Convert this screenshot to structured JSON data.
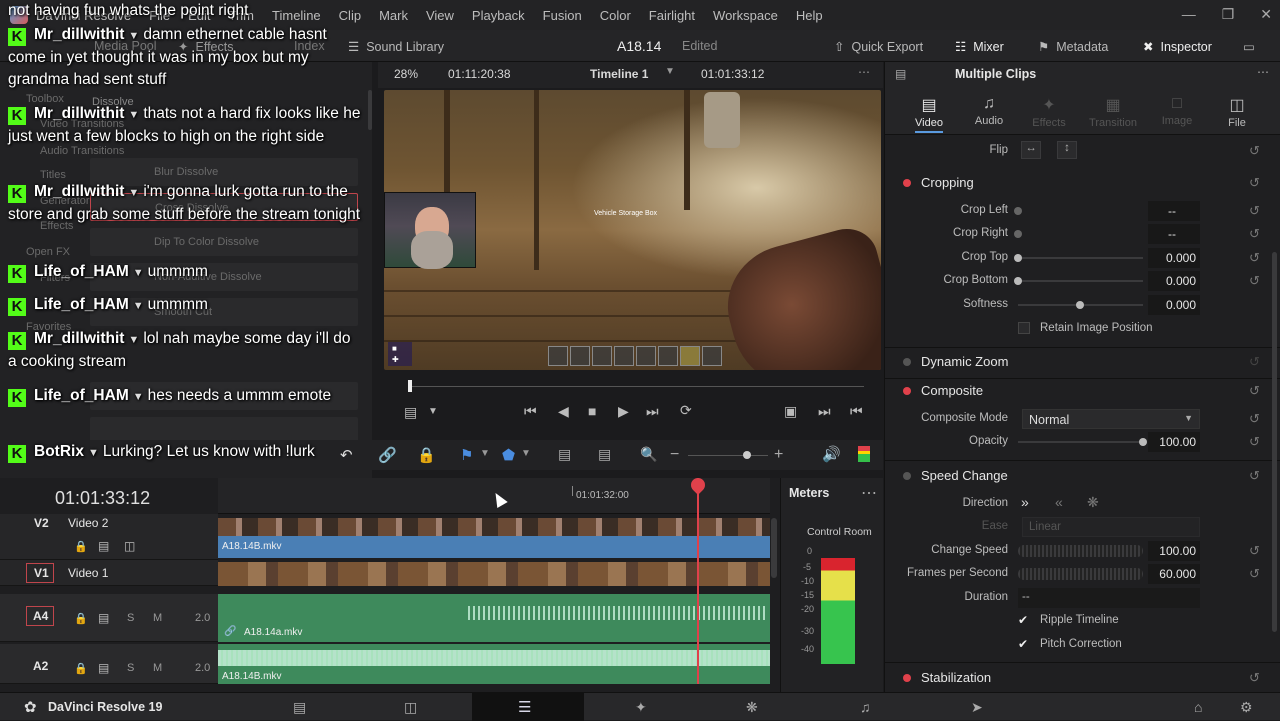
{
  "menubar": {
    "items": [
      "DaVinci Resolve",
      "File",
      "Edit",
      "Trim",
      "Timeline",
      "Clip",
      "Mark",
      "View",
      "Playback",
      "Fusion",
      "Color",
      "Fairlight",
      "Workspace",
      "Help"
    ]
  },
  "toolbar": {
    "media_pool": "Media Pool",
    "effects": "Effects",
    "index": "Index",
    "sound_library": "Sound Library",
    "project_name": "A18.14",
    "project_status": "Edited",
    "quick_export": "Quick Export",
    "mixer": "Mixer",
    "metadata": "Metadata",
    "inspector": "Inspector"
  },
  "effects_panel": {
    "ghost_items": [
      "Toolbox",
      "Video Transitions",
      "Audio Transitions",
      "Titles",
      "Generators",
      "Effects",
      "Open FX",
      "Filters",
      "Favorites"
    ],
    "section_title": "Dissolve",
    "transitions": [
      "Blur Dissolve",
      "Cross Dissolve",
      "Dip To Color Dissolve",
      "Non-Additive Dissolve",
      "Smooth Cut"
    ]
  },
  "viewer": {
    "zoom": "28%",
    "timecode_left": "01:11:20:38",
    "timeline_name": "Timeline 1",
    "timecode_right": "01:01:33:12",
    "game_text": "Vehicle Storage Box"
  },
  "timeline": {
    "current_timecode": "01:01:33:12",
    "ruler_mark": "01:01:32:00",
    "tracks": [
      {
        "id": "V2",
        "name": "Video 2",
        "clip": "A18.14B.mkv"
      },
      {
        "id": "V1",
        "name": "Video 1",
        "clip": ""
      },
      {
        "id": "A4",
        "name": "",
        "level": "2.0",
        "clip": "A18.14a.mkv"
      },
      {
        "id": "A2",
        "name": "",
        "level": "2.0",
        "clip": "A18.14B.mkv"
      }
    ]
  },
  "meters": {
    "title": "Meters",
    "control_room": "Control Room",
    "scale": [
      "0",
      "-5",
      "-10",
      "-15",
      "-20",
      "-30",
      "-40"
    ]
  },
  "inspector": {
    "title": "Multiple Clips",
    "tabs": [
      "Video",
      "Audio",
      "Effects",
      "Transition",
      "Image",
      "File"
    ],
    "flip_label": "Flip",
    "cropping": {
      "title": "Cropping",
      "crop_left": {
        "label": "Crop Left",
        "value": "--"
      },
      "crop_right": {
        "label": "Crop Right",
        "value": "--"
      },
      "crop_top": {
        "label": "Crop Top",
        "value": "0.000"
      },
      "crop_bottom": {
        "label": "Crop Bottom",
        "value": "0.000"
      },
      "softness": {
        "label": "Softness",
        "value": "0.000"
      },
      "retain": "Retain Image Position"
    },
    "dynamic_zoom": "Dynamic Zoom",
    "composite": {
      "title": "Composite",
      "mode_label": "Composite Mode",
      "mode_value": "Normal",
      "opacity_label": "Opacity",
      "opacity_value": "100.00"
    },
    "speed_change": {
      "title": "Speed Change",
      "direction_label": "Direction",
      "ease_label": "Ease",
      "ease_value": "Linear",
      "change_speed_label": "Change Speed",
      "change_speed_value": "100.00",
      "fps_label": "Frames per Second",
      "fps_value": "60.000",
      "duration_label": "Duration",
      "duration_value": "--",
      "ripple": "Ripple Timeline",
      "pitch": "Pitch Correction"
    },
    "stabilization": "Stabilization"
  },
  "chat": [
    {
      "user": "",
      "text": "not having fun whats the point right"
    },
    {
      "user": "Mr_dillwithit",
      "text": "damn ethernet cable hasnt come in yet thought it was in my box but my grandma had sent stuff"
    },
    {
      "user": "Mr_dillwithit",
      "text": "thats not a hard fix looks like he just went a few blocks to high on the right side"
    },
    {
      "user": "Mr_dillwithit",
      "text": "i'm gonna lurk gotta run to the store and grab some stuff before the stream tonight"
    },
    {
      "user": "Life_of_HAM",
      "text": "ummmm"
    },
    {
      "user": "Life_of_HAM",
      "text": "ummmm"
    },
    {
      "user": "Mr_dillwithit",
      "text": "lol nah maybe some day i'll do a cooking stream"
    },
    {
      "user": "Life_of_HAM",
      "text": "hes needs a ummm emote"
    },
    {
      "user": "BotRix",
      "text": "Lurking? Let us know with !lurk"
    }
  ],
  "bottombar": {
    "app_name": "DaVinci Resolve 19"
  },
  "colors": {
    "accent_red": "#e0414b",
    "kick_green": "#53fc18",
    "video_clip": "#4a7fb5",
    "audio_clip": "#3e8a5c"
  }
}
